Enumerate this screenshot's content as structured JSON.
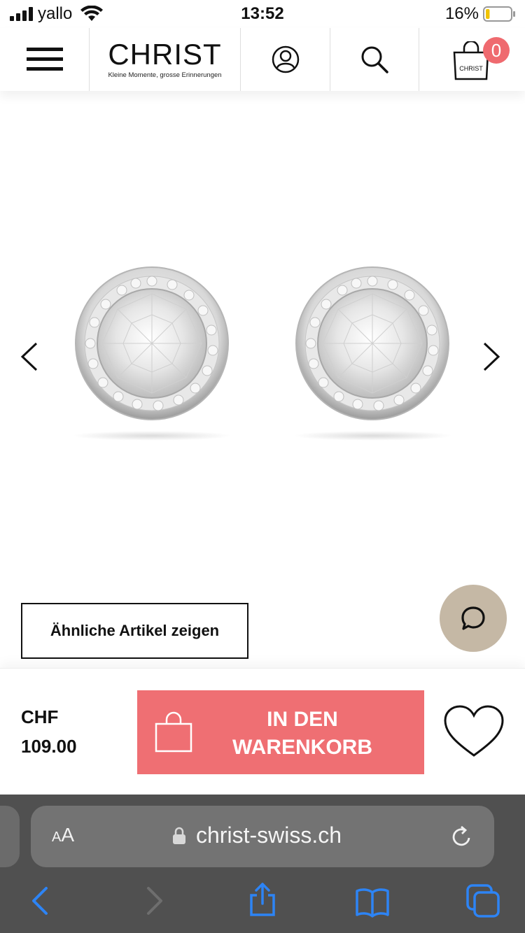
{
  "status_bar": {
    "carrier": "yallo",
    "time": "13:52",
    "battery_percent": "16%",
    "battery_level": 0.16
  },
  "header": {
    "logo": "CHRIST",
    "tagline": "Kleine Momente, grosse Erinnerungen",
    "cart_count": "0",
    "cart_bag_label": "CHRIST",
    "icons": [
      "hamburger-menu-icon",
      "account-icon",
      "search-icon",
      "shopping-bag-icon"
    ]
  },
  "gallery": {
    "product_image": "round halo stud earrings",
    "prev_icon": "chevron-left-icon",
    "next_icon": "chevron-right-icon"
  },
  "actions": {
    "similar_label": "Ähnliche Artikel zeigen",
    "chat_icon": "chat-bubble-icon"
  },
  "purchase": {
    "currency": "CHF",
    "price": "109.00",
    "cta_label_line1": "IN DEN",
    "cta_label_line2": "WARENKORB",
    "wishlist_icon": "heart-icon",
    "colors": {
      "cta": "#ef6f73",
      "chat": "#c5b8a5",
      "badge": "#ef6a6f"
    }
  },
  "browser": {
    "aa_label_small": "A",
    "aa_label_large": "A",
    "url": "christ-swiss.ch",
    "toolbar_icons": [
      "back-icon",
      "forward-icon",
      "share-icon",
      "bookmarks-icon",
      "tabs-icon"
    ]
  }
}
